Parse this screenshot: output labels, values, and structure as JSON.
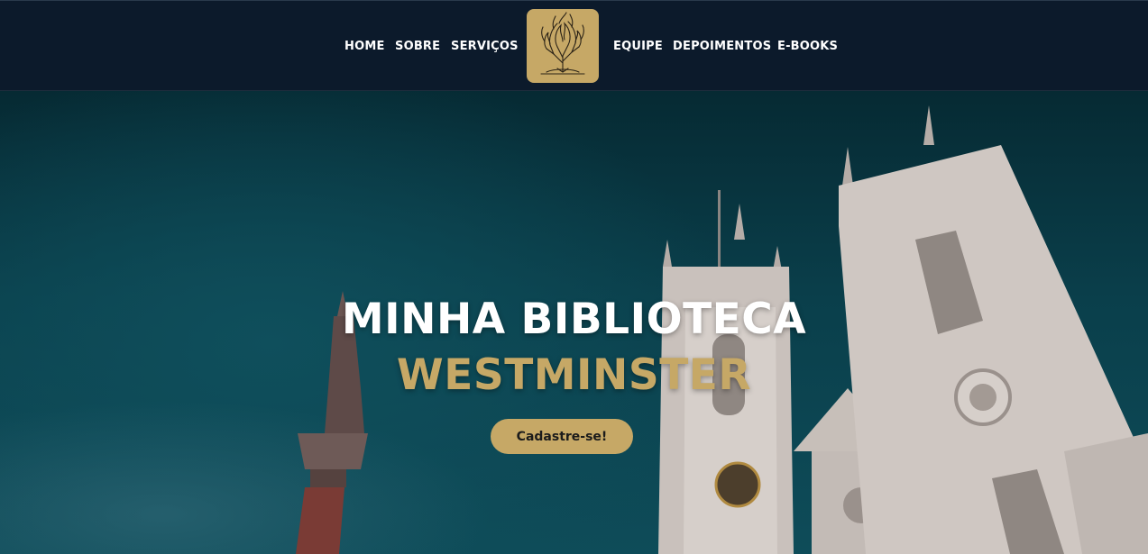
{
  "nav": {
    "left_items": [
      {
        "label": "HOME"
      },
      {
        "label": "SOBRE"
      },
      {
        "label": "SERVIÇOS"
      }
    ],
    "right_items": [
      {
        "label": "EQUIPE"
      },
      {
        "label": "DEPOIMENTOS"
      },
      {
        "label": "E-BOOKS"
      }
    ],
    "logo_icon": "burning-bush-icon"
  },
  "hero": {
    "title_line1": "MINHA BIBLIOTECA",
    "title_line2": "WESTMINSTER",
    "cta_label": "Cadastre-se!",
    "background": "westminster-abbey-photo"
  },
  "colors": {
    "navbar": "#0c1a2b",
    "accent_gold": "#c6a866",
    "hero_teal": "#0a3f4b",
    "white": "#ffffff"
  }
}
